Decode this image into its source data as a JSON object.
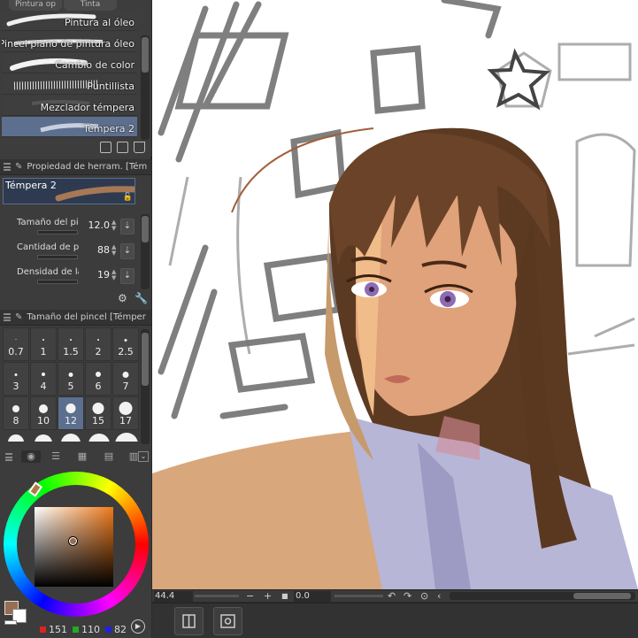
{
  "brush_panel": {
    "tabs": [
      "Pintura op",
      "Tinta"
    ],
    "items": [
      {
        "label": "Pintura al óleo",
        "selected": false
      },
      {
        "label": "Pincel plano de pintura óleo",
        "selected": false
      },
      {
        "label": "Cambio de color",
        "selected": false
      },
      {
        "label": "Puntillista",
        "selected": false
      },
      {
        "label": "Mezclador témpera",
        "selected": false
      },
      {
        "label": "Témpera 2",
        "selected": true
      }
    ]
  },
  "tool_property": {
    "header": "Propiedad de herram. [Tém",
    "preset": "Témpera 2",
    "rows": [
      {
        "label": "Tamaño del pincel",
        "value": "12.0"
      },
      {
        "label": "Cantidad de pintura",
        "value": "88"
      },
      {
        "label": "Densidad de la pintura",
        "value": "19"
      }
    ]
  },
  "brush_size": {
    "header": "Tamaño del pincel [Témper",
    "sizes": [
      "0.7",
      "1",
      "1.5",
      "2",
      "2.5",
      "3",
      "4",
      "5",
      "6",
      "7",
      "8",
      "10",
      "12",
      "15",
      "17"
    ],
    "selected": "12"
  },
  "color": {
    "r": "151",
    "g": "110",
    "b": "82",
    "main_hex": "#976e52",
    "hue_hex": "#ef7a1a"
  },
  "status": {
    "zoom": "44.4",
    "angle": "0.0"
  }
}
